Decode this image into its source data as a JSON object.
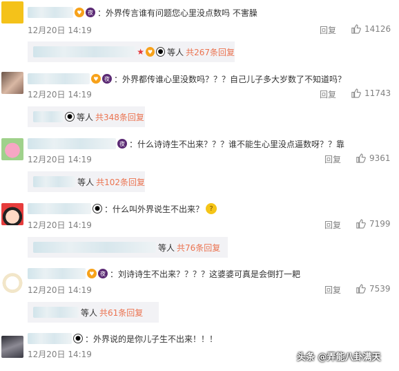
{
  "comments": [
    {
      "text": "：外界传言谁有问题您心里没点数吗 不害臊",
      "time": "12月20日 14:19",
      "reply_label": "回复",
      "likes": "14126",
      "sub": {
        "who": "等人",
        "count": "共267条回复"
      }
    },
    {
      "text": "：外界都传谁心里没数吗？？？自己儿子多大岁数了不知道吗？",
      "time": "12月20日 14:19",
      "reply_label": "回复",
      "likes": "11743",
      "sub": {
        "who": "等人",
        "count": "共348条回复"
      }
    },
    {
      "text": "：什么诗诗生不出来？？？谁不能生心里没点逼数呀？？靠",
      "time": "12月20日 14:19",
      "reply_label": "回复",
      "likes": "9361",
      "sub": {
        "who": "等人",
        "count": "共102条回复"
      }
    },
    {
      "text": "：什么叫外界说生不出来？",
      "time": "12月20日 14:19",
      "reply_label": "回复",
      "likes": "7199",
      "sub": {
        "who": "等人",
        "count": "共76条回复"
      }
    },
    {
      "text": "：刘诗诗生不出来？？？？这婆婆可真是会倒打一耙",
      "time": "12月20日 14:19",
      "reply_label": "回复",
      "likes": "7539",
      "sub": {
        "who": "等人",
        "count": "共61条回复"
      }
    },
    {
      "text": "：外界说的是你儿子生不出来！！！",
      "time": "12月20日 14:19"
    }
  ],
  "watermark": "头条 @弄能八卦满天",
  "accent_color": "#eb7350"
}
